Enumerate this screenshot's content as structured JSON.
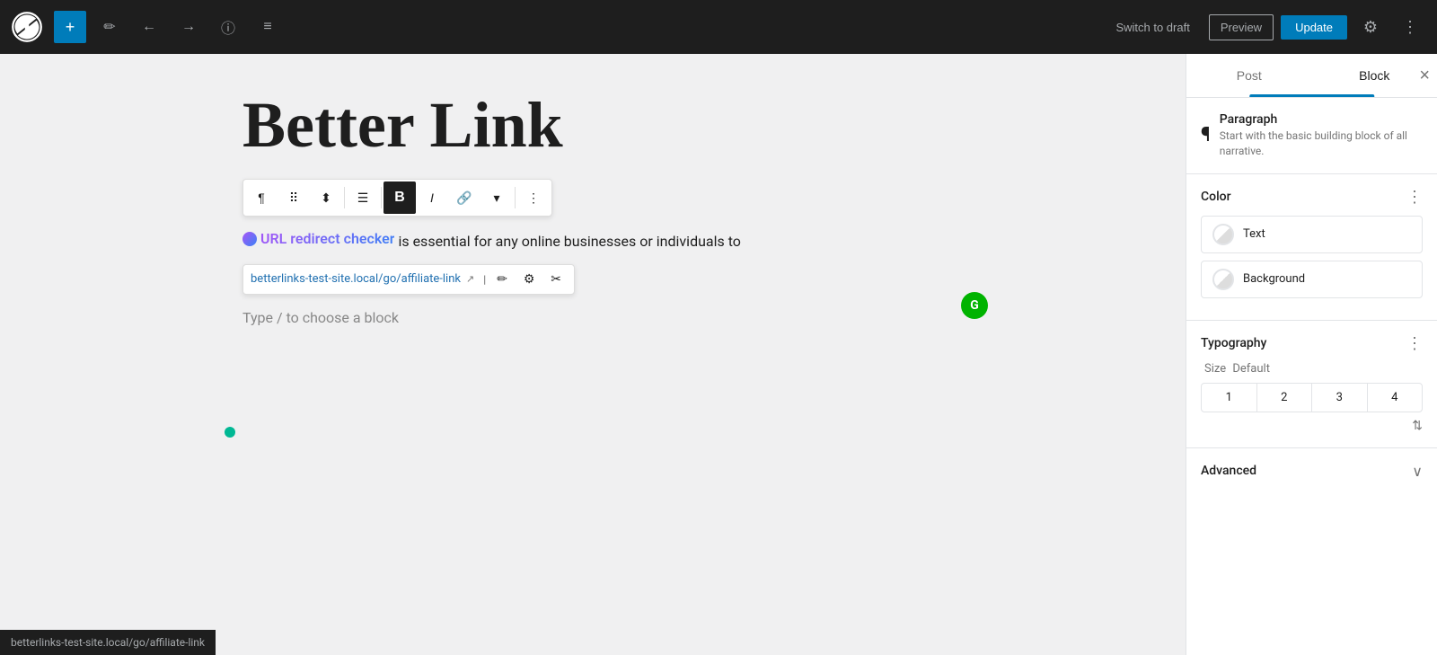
{
  "topbar": {
    "add_label": "+",
    "pencil_label": "✏",
    "undo_label": "←",
    "redo_label": "→",
    "info_label": "ℹ",
    "list_label": "≡",
    "switch_to_draft": "Switch to draft",
    "preview": "Preview",
    "update": "Update",
    "settings_icon": "⚙",
    "more_icon": "⋮"
  },
  "editor": {
    "post_title": "Better Link",
    "paragraph_text": " is essential for any online businesses or individuals to",
    "link_text": "URL redirect checker",
    "link_href": "betterlinks-test-site.local/go/affiliate-link",
    "type_choose": "Type / to choose a block"
  },
  "sidebar": {
    "tab_post": "Post",
    "tab_block": "Block",
    "close_icon": "×",
    "paragraph_section": {
      "icon": "¶",
      "title": "Paragraph",
      "desc": "Start with the basic building block of all narrative."
    },
    "color_section": {
      "title": "Color",
      "more_icon": "⋮",
      "options": [
        {
          "label": "Text"
        },
        {
          "label": "Background"
        }
      ]
    },
    "typography_section": {
      "title": "Typography",
      "more_icon": "⋮",
      "size_label": "Size",
      "size_default": "Default",
      "sizes": [
        "1",
        "2",
        "3",
        "4"
      ]
    },
    "advanced_section": {
      "title": "Advanced",
      "chevron": "∨"
    }
  },
  "statusbar": {
    "url": "betterlinks-test-site.local/go/affiliate-link"
  }
}
